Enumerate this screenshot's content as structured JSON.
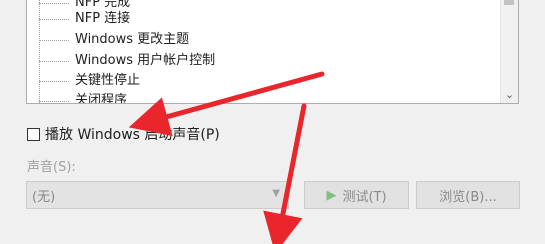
{
  "sound_events": {
    "items": [
      {
        "label": "NFP 完成"
      },
      {
        "label": "NFP 连接"
      },
      {
        "label": "Windows 更改主题"
      },
      {
        "label": "Windows 用户帐户控制"
      },
      {
        "label": "关键性停止"
      },
      {
        "label": "关闭程序"
      }
    ]
  },
  "startup_sound": {
    "label": "播放 Windows 启动声音(P)",
    "checked": false
  },
  "sound_field": {
    "label": "声音(S):",
    "value": "(无)"
  },
  "buttons": {
    "test_label": "测试(T)",
    "browse_label": "浏览(B)..."
  },
  "annotation": {
    "arrow_color": "#e8262b"
  },
  "icons": {
    "play": "play-icon",
    "scroll_down": "chevron-down-icon",
    "dropdown": "chevron-down-icon"
  }
}
